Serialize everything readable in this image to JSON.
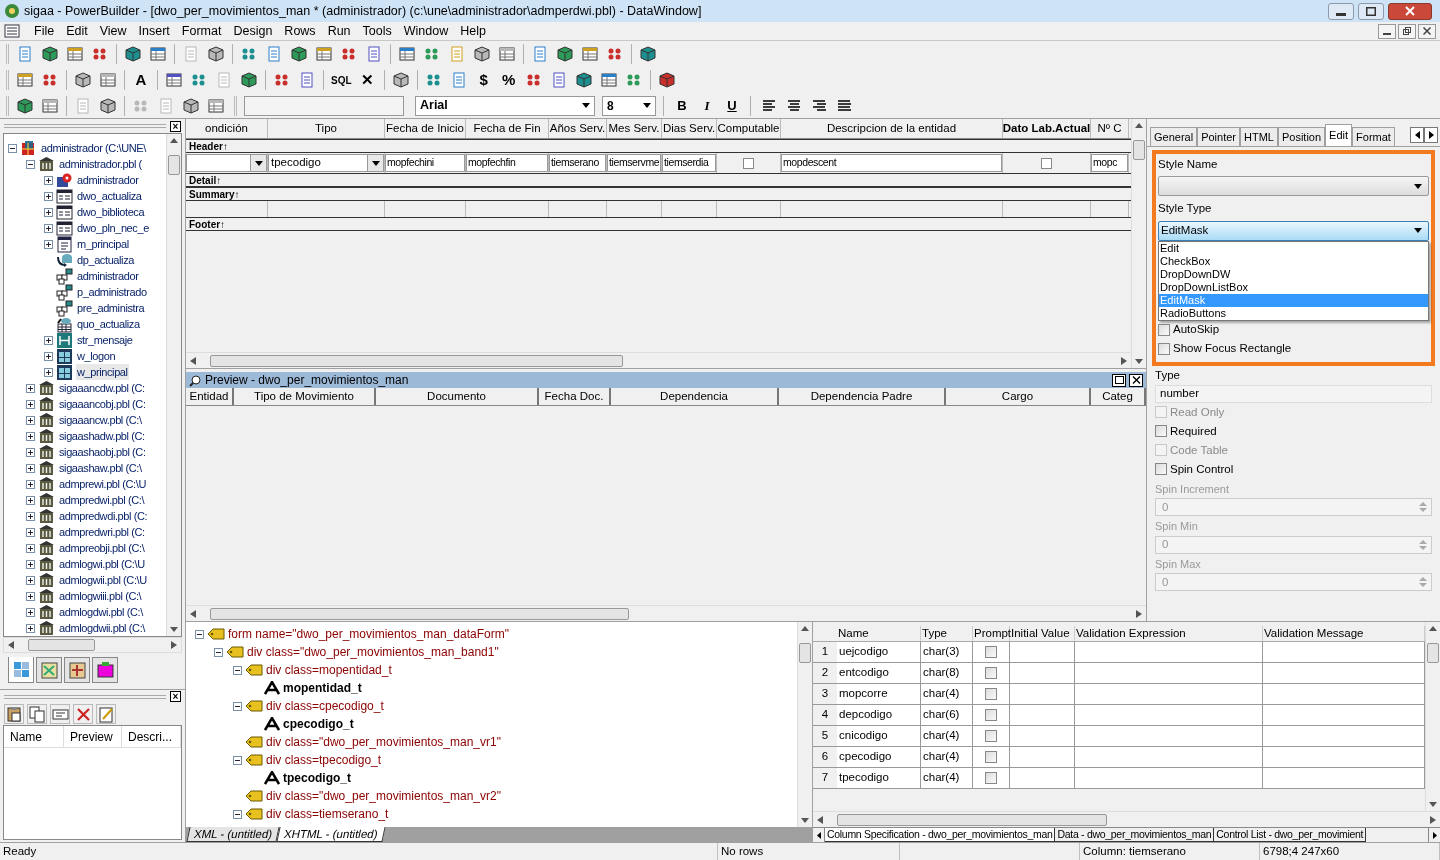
{
  "window": {
    "title": "sigaa - PowerBuilder - [dwo_per_movimientos_man * (administrador) (c:\\une\\administrador\\admperdwi.pbl) - DataWindow]"
  },
  "menu": [
    "File",
    "Edit",
    "View",
    "Insert",
    "Format",
    "Design",
    "Rows",
    "Run",
    "Tools",
    "Window",
    "Help"
  ],
  "toolbars": [
    [
      {
        "kind": "icon",
        "disabled": false
      },
      {
        "kind": "icon",
        "disabled": false
      },
      {
        "kind": "icon",
        "disabled": false
      },
      {
        "kind": "icon",
        "disabled": false
      },
      {
        "kind": "separator"
      },
      {
        "kind": "icon",
        "disabled": false
      },
      {
        "kind": "icon",
        "disabled": false
      },
      {
        "kind": "separator"
      },
      {
        "kind": "icon",
        "disabled": true
      },
      {
        "kind": "icon",
        "disabled": true
      },
      {
        "kind": "separator"
      },
      {
        "kind": "icon",
        "disabled": false
      },
      {
        "kind": "icon",
        "disabled": false
      },
      {
        "kind": "icon",
        "disabled": false
      },
      {
        "kind": "icon",
        "disabled": false
      },
      {
        "kind": "icon",
        "disabled": false
      },
      {
        "kind": "icon",
        "disabled": false
      },
      {
        "kind": "separator"
      },
      {
        "kind": "icon",
        "disabled": false
      },
      {
        "kind": "icon",
        "disabled": false
      },
      {
        "kind": "icon",
        "disabled": false
      },
      {
        "kind": "icon",
        "disabled": true
      },
      {
        "kind": "icon",
        "disabled": true
      },
      {
        "kind": "separator"
      },
      {
        "kind": "icon",
        "disabled": false
      },
      {
        "kind": "icon",
        "disabled": false
      },
      {
        "kind": "icon",
        "disabled": false
      },
      {
        "kind": "icon",
        "disabled": false
      },
      {
        "kind": "separator"
      },
      {
        "kind": "icon",
        "disabled": false
      }
    ],
    [
      {
        "kind": "icon",
        "disabled": false
      },
      {
        "kind": "icon",
        "disabled": false
      },
      {
        "kind": "separator"
      },
      {
        "kind": "icon",
        "disabled": true
      },
      {
        "kind": "icon",
        "disabled": true
      },
      {
        "kind": "separator"
      },
      {
        "kind": "text",
        "text": "A",
        "disabled": false
      },
      {
        "kind": "separator"
      },
      {
        "kind": "icon",
        "disabled": false
      },
      {
        "kind": "icon",
        "disabled": false
      },
      {
        "kind": "icon",
        "disabled": true
      },
      {
        "kind": "icon",
        "disabled": false
      },
      {
        "kind": "separator"
      },
      {
        "kind": "icon",
        "disabled": false
      },
      {
        "kind": "icon",
        "disabled": false
      },
      {
        "kind": "separator"
      },
      {
        "kind": "text",
        "text": "SQL",
        "disabled": false
      },
      {
        "kind": "text",
        "text": "✕",
        "disabled": false
      },
      {
        "kind": "separator"
      },
      {
        "kind": "icon",
        "disabled": true
      },
      {
        "kind": "separator"
      },
      {
        "kind": "icon",
        "disabled": false
      },
      {
        "kind": "icon",
        "disabled": false
      },
      {
        "kind": "text",
        "text": "$",
        "disabled": false
      },
      {
        "kind": "text",
        "text": "%",
        "disabled": false
      },
      {
        "kind": "icon",
        "disabled": false
      },
      {
        "kind": "icon",
        "disabled": false
      },
      {
        "kind": "icon",
        "disabled": false
      },
      {
        "kind": "icon",
        "disabled": false
      },
      {
        "kind": "icon",
        "disabled": false
      },
      {
        "kind": "separator"
      },
      {
        "kind": "icon",
        "disabled": false
      }
    ]
  ],
  "format_bar": {
    "tools": [
      {
        "kind": "icon",
        "disabled": false
      },
      {
        "kind": "icon",
        "disabled": true
      },
      {
        "kind": "separator"
      },
      {
        "kind": "icon",
        "disabled": true
      },
      {
        "kind": "icon",
        "disabled": true
      },
      {
        "kind": "separator"
      },
      {
        "kind": "icon",
        "disabled": true
      },
      {
        "kind": "icon",
        "disabled": true
      },
      {
        "kind": "icon",
        "disabled": true
      },
      {
        "kind": "icon",
        "disabled": true
      }
    ],
    "font": "Arial",
    "size": "8",
    "styles": [
      "B",
      "I",
      "U"
    ]
  },
  "library_tree": [
    {
      "label": "administrador (C:\\UNE\\",
      "kind": "target",
      "expanded": true,
      "selected": false,
      "children": [
        {
          "label": "administrador.pbl (",
          "kind": "library",
          "expanded": true,
          "selected": false,
          "children": [
            {
              "label": "administrador",
              "kind": "app",
              "expanded": false,
              "selected": false
            },
            {
              "label": "dwo_actualiza",
              "kind": "datawindow",
              "expanded": false,
              "selected": false
            },
            {
              "label": "dwo_biblioteca",
              "kind": "datawindow",
              "expanded": false,
              "selected": false
            },
            {
              "label": "dwo_pln_nec_e",
              "kind": "datawindow",
              "expanded": false,
              "selected": false
            },
            {
              "label": "m_principal",
              "kind": "menu",
              "expanded": false,
              "selected": false
            },
            {
              "label": "dp_actualiza",
              "kind": "pipeline",
              "selected": false
            },
            {
              "label": "administrador",
              "kind": "project",
              "selected": false
            },
            {
              "label": "p_administrado",
              "kind": "project",
              "selected": false
            },
            {
              "label": "pre_administra",
              "kind": "project",
              "selected": false
            },
            {
              "label": "quo_actualiza",
              "kind": "query",
              "selected": false
            },
            {
              "label": "str_mensaje",
              "kind": "structure",
              "expanded": false,
              "selected": false
            },
            {
              "label": "w_logon",
              "kind": "window",
              "expanded": false,
              "selected": false
            },
            {
              "label": "w_principal",
              "kind": "window",
              "expanded": false,
              "selected": true
            }
          ]
        },
        {
          "label": "sigaaancdw.pbl (C:",
          "kind": "library",
          "expanded": false,
          "selected": false
        },
        {
          "label": "sigaaancobj.pbl (C:",
          "kind": "library",
          "expanded": false,
          "selected": false
        },
        {
          "label": "sigaaancw.pbl (C:\\",
          "kind": "library",
          "expanded": false,
          "selected": false
        },
        {
          "label": "sigaashadw.pbl (C:",
          "kind": "library",
          "expanded": false,
          "selected": false
        },
        {
          "label": "sigaashaobj.pbl (C:",
          "kind": "library",
          "expanded": false,
          "selected": false
        },
        {
          "label": "sigaashaw.pbl (C:\\",
          "kind": "library",
          "expanded": false,
          "selected": false
        },
        {
          "label": "admprewi.pbl (C:\\U",
          "kind": "library",
          "expanded": false,
          "selected": false
        },
        {
          "label": "admpredwi.pbl (C:\\",
          "kind": "library",
          "expanded": false,
          "selected": false
        },
        {
          "label": "admpredwdi.pbl (C:",
          "kind": "library",
          "expanded": false,
          "selected": false
        },
        {
          "label": "admpredwri.pbl (C:",
          "kind": "library",
          "expanded": false,
          "selected": false
        },
        {
          "label": "admpreobji.pbl (C:\\",
          "kind": "library",
          "expanded": false,
          "selected": false
        },
        {
          "label": "admlogwi.pbl (C:\\U",
          "kind": "library",
          "expanded": false,
          "selected": false
        },
        {
          "label": "admlogwii.pbl (C:\\U",
          "kind": "library",
          "expanded": false,
          "selected": false
        },
        {
          "label": "admlogwiii.pbl (C:\\",
          "kind": "library",
          "expanded": false,
          "selected": false
        },
        {
          "label": "admlogdwi.pbl (C:\\",
          "kind": "library",
          "expanded": false,
          "selected": false
        },
        {
          "label": "admlogdwii.pbl (C:\\",
          "kind": "library",
          "expanded": false,
          "selected": false
        }
      ]
    }
  ],
  "tree_panel": {
    "close": "×"
  },
  "left_tabs": [
    {
      "selected": true
    },
    {
      "selected": false
    },
    {
      "selected": false
    },
    {
      "selected": false
    }
  ],
  "clip_panel": {
    "close": "×",
    "columns": [
      "Name",
      "Preview",
      "Descri..."
    ]
  },
  "design": {
    "columns": [
      {
        "label": "ondición",
        "bold": false
      },
      {
        "label": "Tipo",
        "bold": false
      },
      {
        "label": "Fecha de Inicio",
        "bold": false
      },
      {
        "label": "Fecha de Fin",
        "bold": false
      },
      {
        "label": "Años Serv.",
        "bold": false
      },
      {
        "label": "Mes Serv.",
        "bold": false
      },
      {
        "label": "Dias Serv.",
        "bold": false
      },
      {
        "label": "Computable",
        "bold": false
      },
      {
        "label": "Descripcion de la entidad",
        "bold": false
      },
      {
        "label": "Dato Lab.Actual",
        "bold": true
      },
      {
        "label": "Nº C",
        "bold": false
      }
    ],
    "fields": [
      {
        "kind": "dropdown"
      },
      {
        "kind": "dropdown",
        "text": "tpecodigo"
      },
      {
        "kind": "text",
        "text": "mopfechini"
      },
      {
        "kind": "text",
        "text": "mopfechfin"
      },
      {
        "kind": "text",
        "text": "tiemserano"
      },
      {
        "kind": "text",
        "text": "tiemservme"
      },
      {
        "kind": "text",
        "text": "tiemserdia"
      },
      {
        "kind": "checkbox"
      },
      {
        "kind": "text",
        "text": "mopdescent"
      },
      {
        "kind": "checkbox"
      },
      {
        "kind": "text",
        "text": "mopc"
      }
    ],
    "bands": [
      "Header↑",
      "Detail↑",
      "Summary↑",
      "Footer↑"
    ]
  },
  "preview": {
    "title": "Preview - dwo_per_movimientos_man",
    "columns": [
      "Entidad",
      "Tipo de Movimiento",
      "Documento",
      "Fecha Doc.",
      "Dependencia",
      "Dependencia Padre",
      "Cargo",
      "Categ"
    ]
  },
  "properties": {
    "tabs": [
      {
        "label": "General",
        "selected": false
      },
      {
        "label": "Pointer",
        "selected": false
      },
      {
        "label": "HTML",
        "selected": false
      },
      {
        "label": "Position",
        "selected": false
      },
      {
        "label": "Edit",
        "selected": true
      },
      {
        "label": "Format",
        "selected": false
      }
    ],
    "style_name_label": "Style Name",
    "style_type_label": "Style Type",
    "style_type": "EditMask",
    "style_options": [
      {
        "label": "Edit",
        "selected": false
      },
      {
        "label": "CheckBox",
        "selected": false
      },
      {
        "label": "DropDownDW",
        "selected": false
      },
      {
        "label": "DropDownListBox",
        "selected": false
      },
      {
        "label": "EditMask",
        "selected": true
      },
      {
        "label": "RadioButtons",
        "selected": false
      }
    ],
    "items": [
      {
        "kind": "checkbox",
        "label": "AutoSkip",
        "checked": false,
        "disabled": false
      },
      {
        "kind": "checkbox",
        "label": "Show Focus Rectangle",
        "checked": false,
        "disabled": false
      },
      {
        "kind": "field",
        "label": "Type",
        "value": "number"
      },
      {
        "kind": "checkbox",
        "label": "Read Only",
        "checked": false,
        "disabled": true
      },
      {
        "kind": "checkbox",
        "label": "Required",
        "checked": false,
        "disabled": false
      },
      {
        "kind": "checkbox",
        "label": "Code Table",
        "checked": false,
        "disabled": true
      },
      {
        "kind": "checkbox",
        "label": "Spin Control",
        "checked": false,
        "disabled": false
      },
      {
        "kind": "spin",
        "label": "Spin Increment",
        "value": "0",
        "disabled": true
      },
      {
        "kind": "spin",
        "label": "Spin Min",
        "value": "0",
        "disabled": true
      },
      {
        "kind": "spin",
        "label": "Spin Max",
        "value": "0",
        "disabled": true
      }
    ]
  },
  "xml_tree": [
    {
      "kind": "tag",
      "label": "form name=\"dwo_per_movimientos_man_dataForm\"",
      "expanded": true,
      "children": [
        {
          "kind": "tag",
          "label": "div class=\"dwo_per_movimientos_man_band1\"",
          "expanded": true,
          "children": [
            {
              "kind": "tag",
              "label": "div class=mopentidad_t",
              "expanded": true,
              "children": [
                {
                  "kind": "text",
                  "label": "mopentidad_t"
                }
              ]
            },
            {
              "kind": "tag",
              "label": "div class=cpecodigo_t",
              "expanded": true,
              "children": [
                {
                  "kind": "text",
                  "label": "cpecodigo_t"
                }
              ]
            },
            {
              "kind": "tag",
              "label": "div class=\"dwo_per_movimientos_man_vr1\""
            },
            {
              "kind": "tag",
              "label": "div class=tpecodigo_t",
              "expanded": true,
              "children": [
                {
                  "kind": "text",
                  "label": "tpecodigo_t"
                }
              ]
            },
            {
              "kind": "tag",
              "label": "div class=\"dwo_per_movimientos_man_vr2\""
            },
            {
              "kind": "tag",
              "label": "div class=tiemserano_t",
              "expanded": true
            }
          ]
        }
      ]
    }
  ],
  "xml_tabs": [
    {
      "label": "XML - (untitled)",
      "selected": false
    },
    {
      "label": "XHTML - (untitled)",
      "selected": true
    }
  ],
  "column_spec": {
    "columns": [
      "Name",
      "Type",
      "Prompt",
      "Initial Value",
      "Validation Expression",
      "Validation Message"
    ],
    "rows": [
      {
        "n": "1",
        "name": "uejcodigo",
        "type": "char(3)",
        "prompt": false
      },
      {
        "n": "2",
        "name": "entcodigo",
        "type": "char(8)",
        "prompt": false
      },
      {
        "n": "3",
        "name": "mopcorre",
        "type": "char(4)",
        "prompt": false
      },
      {
        "n": "4",
        "name": "depcodigo",
        "type": "char(6)",
        "prompt": false
      },
      {
        "n": "5",
        "name": "cnicodigo",
        "type": "char(4)",
        "prompt": false
      },
      {
        "n": "6",
        "name": "cpecodigo",
        "type": "char(4)",
        "prompt": false
      },
      {
        "n": "7",
        "name": "tpecodigo",
        "type": "char(4)",
        "prompt": false
      }
    ]
  },
  "bottom_tabs": [
    {
      "label": "Column Specification - dwo_per_movimientos_man",
      "selected": true
    },
    {
      "label": "Data - dwo_per_movimientos_man",
      "selected": false
    },
    {
      "label": "Control List - dwo_per_movimient",
      "selected": false
    }
  ],
  "status_bar": [
    "Ready",
    "No rows",
    "Column: tiemserano",
    "6798;4 247x60"
  ]
}
